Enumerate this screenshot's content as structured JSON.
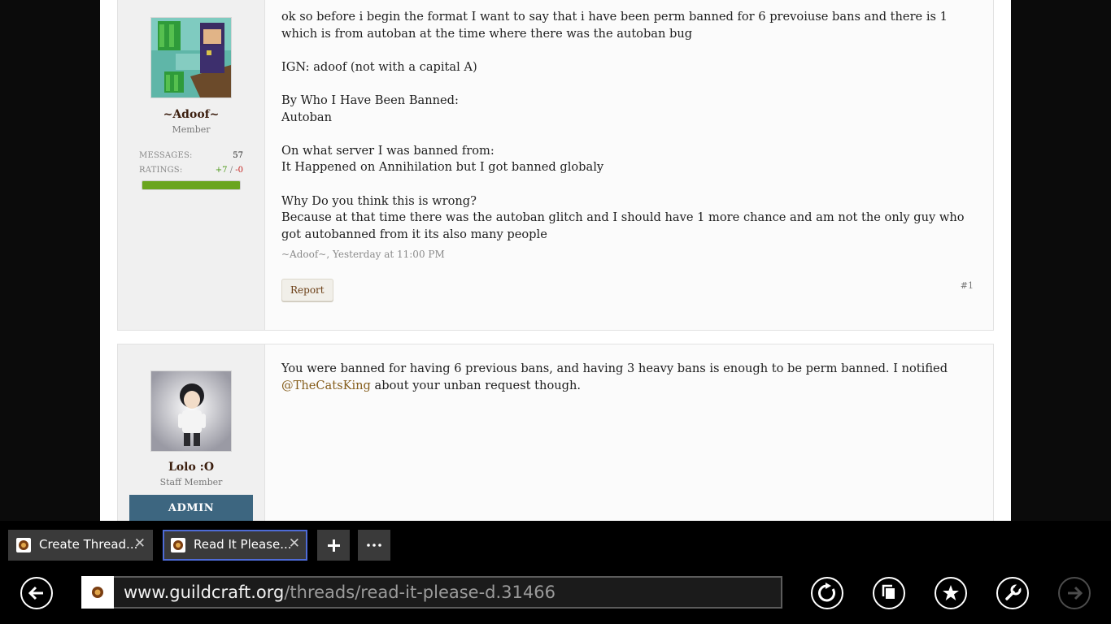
{
  "posts": [
    {
      "author": "~Adoof~",
      "role": "Member",
      "stats": {
        "messages_label": "MESSAGES:",
        "messages": "57",
        "ratings_label": "RATINGS:",
        "ratings_pos": "+7",
        "ratings_sep": " / ",
        "ratings_neg": "-0",
        "rating_fraction": 1.0
      },
      "body": [
        "ok so before i begin the format I want to say that i have been perm banned for 6 prevoiuse bans and there is 1 which is from autoban at the time where there was the autoban bug",
        "IGN: adoof (not with a capital A)",
        "By Who I Have Been Banned:",
        "Autoban",
        "On what server I was banned from:",
        "It Happened on Annihilation but I got banned globaly",
        "Why Do you think this is wrong?",
        "Because at that time there was the autoban glitch and I should have 1 more chance and am not the only guy who got autobanned from it its also many people"
      ],
      "meta": "~Adoof~, Yesterday at 11:00 PM",
      "report_label": "Report",
      "post_number": "#1"
    },
    {
      "author": "Lolo :O",
      "role": "Staff Member",
      "banner": "ADMIN",
      "body_before": "You were banned for having 6 previous bans, and having 3 heavy bans is enough to be perm banned. I notified ",
      "mention": "@TheCatsKing",
      "body_after": " about your unban request though."
    }
  ],
  "browser": {
    "tabs": [
      {
        "title": "Create Thread...",
        "active": false
      },
      {
        "title": "Read It Please...",
        "active": true
      }
    ],
    "new_tab_icon": "plus-icon",
    "more_icon": "ellipsis-icon",
    "url_domain": "www.guildcraft.org",
    "url_path": "/threads/read-it-please-d.31466",
    "buttons": [
      "back-icon",
      "refresh-icon",
      "tabs-icon",
      "favorite-icon",
      "tools-icon",
      "forward-icon"
    ],
    "accent": "#4e6bd6"
  }
}
